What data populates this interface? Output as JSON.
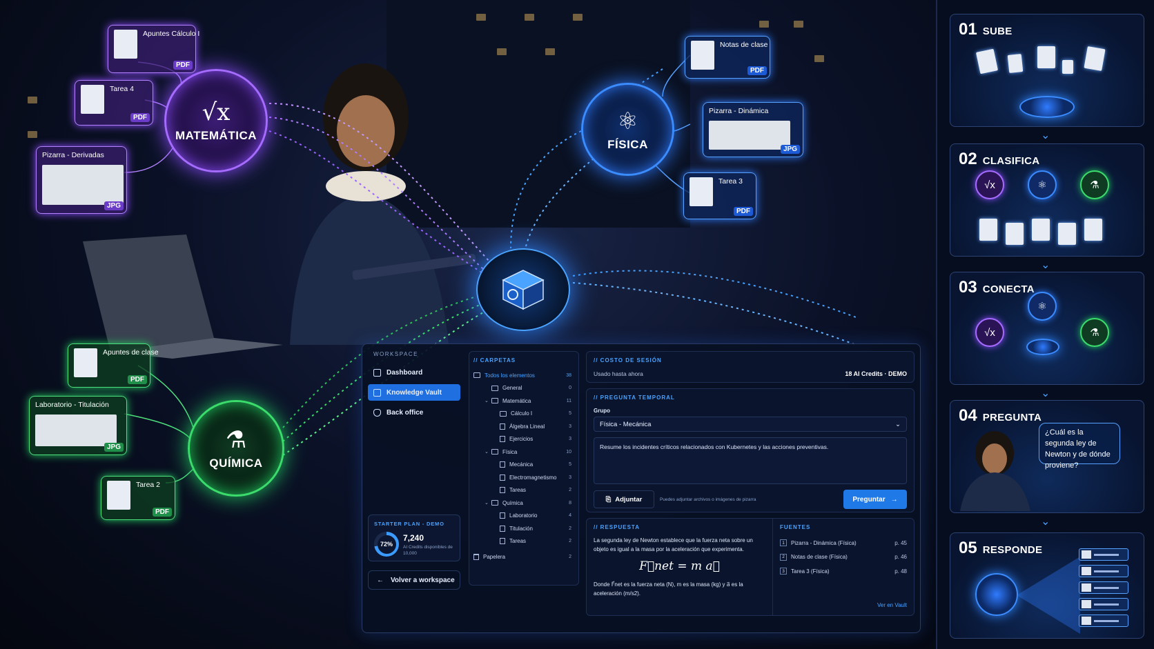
{
  "scene": {
    "hubs": {
      "math": {
        "label": "MATEMÁTICA",
        "symbol": "√x",
        "color": "#a66bff"
      },
      "fis": {
        "label": "FÍSICA",
        "symbol": "⚛",
        "color": "#3b8cff"
      },
      "qui": {
        "label": "QUÍMICA",
        "symbol": "⚗",
        "color": "#3bdc6c"
      }
    },
    "docs": {
      "math": [
        {
          "title": "Apuntes Cálculo I",
          "type": "PDF"
        },
        {
          "title": "Tarea 4",
          "type": "PDF"
        },
        {
          "title": "Pizarra - Derivadas",
          "type": "JPG"
        }
      ],
      "fis": [
        {
          "title": "Notas de clase",
          "type": "PDF"
        },
        {
          "title": "Pizarra - Dinámica",
          "type": "JPG"
        },
        {
          "title": "Tarea 3",
          "type": "PDF"
        }
      ],
      "qui": [
        {
          "title": "Apuntes de clase",
          "type": "PDF"
        },
        {
          "title": "Laboratorio - Titulación",
          "type": "JPG"
        },
        {
          "title": "Tarea 2",
          "type": "PDF"
        }
      ]
    }
  },
  "app": {
    "sidebar": {
      "workspace_label": "WORKSPACE",
      "items": [
        {
          "label": "Dashboard",
          "icon": "dashboard-icon"
        },
        {
          "label": "Knowledge Vault",
          "icon": "vault-icon",
          "active": true
        },
        {
          "label": "Back office",
          "icon": "shield-icon"
        }
      ],
      "plan": {
        "title": "STARTER PLAN - DEMO",
        "percent": "72%",
        "value": "7,240",
        "sub": "AI Credits disponibles de 10,000"
      },
      "back_label": "Volver a workspace"
    },
    "folders": {
      "title": "// CARPETAS",
      "items": [
        {
          "label": "Todos los elementos",
          "count": "38",
          "level": 0,
          "kind": "folder",
          "top": true
        },
        {
          "label": "General",
          "count": "0",
          "level": 1,
          "kind": "folder"
        },
        {
          "label": "Matemática",
          "count": "11",
          "level": 1,
          "kind": "folder-open"
        },
        {
          "label": "Cálculo I",
          "count": "5",
          "level": 2,
          "kind": "folder"
        },
        {
          "label": "Álgebra Lineal",
          "count": "3",
          "level": 2,
          "kind": "file"
        },
        {
          "label": "Ejercicios",
          "count": "3",
          "level": 2,
          "kind": "file"
        },
        {
          "label": "Física",
          "count": "10",
          "level": 1,
          "kind": "folder-open"
        },
        {
          "label": "Mecánica",
          "count": "5",
          "level": 2,
          "kind": "file"
        },
        {
          "label": "Electromagnetismo",
          "count": "3",
          "level": 2,
          "kind": "file"
        },
        {
          "label": "Tareas",
          "count": "2",
          "level": 2,
          "kind": "file"
        },
        {
          "label": "Química",
          "count": "8",
          "level": 1,
          "kind": "folder-open"
        },
        {
          "label": "Laboratorio",
          "count": "4",
          "level": 2,
          "kind": "file"
        },
        {
          "label": "Titulación",
          "count": "2",
          "level": 2,
          "kind": "file"
        },
        {
          "label": "Tareas",
          "count": "2",
          "level": 2,
          "kind": "file"
        },
        {
          "label": "Papelera",
          "count": "2",
          "level": 0,
          "kind": "trash"
        }
      ]
    },
    "cost": {
      "title": "// COSTO DE SESIÓN",
      "label": "Usado hasta ahora",
      "value": "18 AI Credits · DEMO"
    },
    "question": {
      "title": "// PREGUNTA TEMPORAL",
      "group_label": "Grupo",
      "group_value": "Física - Mecánica",
      "text": "Resume los incidentes críticos relacionados con Kubernetes y las acciones preventivas.",
      "attach_label": "Adjuntar",
      "attach_hint": "Puedes adjuntar archivos o imágenes de pizarra",
      "ask_label": "Preguntar"
    },
    "answer": {
      "title": "// RESPUESTA",
      "text": "La segunda ley de Newton establece que la fuerza neta sobre un objeto es igual a la masa por la aceleración que experimenta.",
      "formula": "F⃗net = m a⃗",
      "footnote": "Donde F⃗net es la fuerza neta (N), m es la masa (kg) y a⃗ es la aceleración (m/s2).",
      "sources_title": "FUENTES",
      "sources": [
        {
          "n": "1",
          "label": "Pizarra - Dinámica (Física)",
          "page": "p. 45"
        },
        {
          "n": "2",
          "label": "Notas de clase (Física)",
          "page": "p. 46"
        },
        {
          "n": "3",
          "label": "Tarea 3 (Física)",
          "page": "p. 48"
        }
      ],
      "see_vault": "Ver en Vault"
    }
  },
  "steps": [
    {
      "num": "01",
      "title": "SUBE"
    },
    {
      "num": "02",
      "title": "CLASIFICA"
    },
    {
      "num": "03",
      "title": "CONECTA"
    },
    {
      "num": "04",
      "title": "PREGUNTA",
      "bubble": "¿Cuál es la segunda ley de Newton y de dónde proviene?"
    },
    {
      "num": "05",
      "title": "RESPONDE"
    }
  ]
}
